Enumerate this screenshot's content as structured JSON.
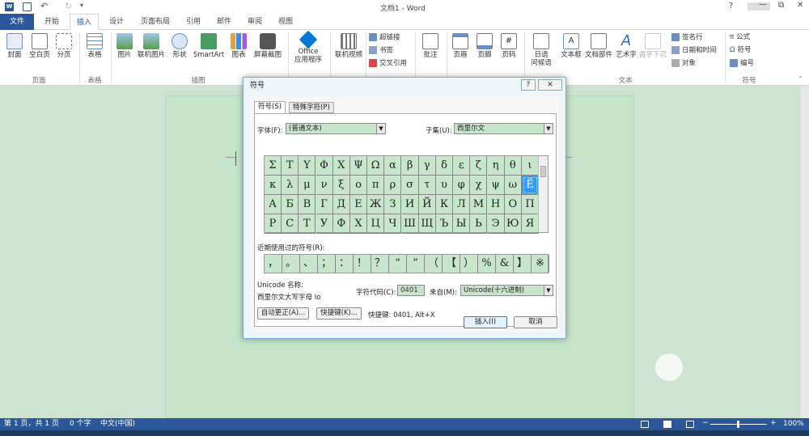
{
  "titlebar": {
    "title": "文档1 - Word",
    "help": "?",
    "restore": "⧉",
    "minimize": "—",
    "close": "✕"
  },
  "tabs": [
    "文件",
    "开始",
    "插入",
    "设计",
    "页面布局",
    "引用",
    "邮件",
    "审阅",
    "视图"
  ],
  "active_tab": "插入",
  "ribbon": {
    "pages": {
      "label": "页面",
      "items": [
        "封面",
        "空白页",
        "分页"
      ]
    },
    "tables": {
      "label": "表格",
      "items": [
        "表格"
      ]
    },
    "illustrations": {
      "label": "插图",
      "items": [
        "图片",
        "联机图片",
        "形状",
        "SmartArt",
        "图表",
        "屏幕截图"
      ]
    },
    "apps": {
      "items": [
        "Office",
        "应用程序"
      ],
      "label": "应用程序"
    },
    "media": {
      "items": [
        "联机视频"
      ],
      "label": "媒体"
    },
    "links": {
      "items": [
        "超链接",
        "书签",
        "交叉引用"
      ],
      "label": "链接"
    },
    "comments": {
      "items": [
        "批注"
      ],
      "label": "批注"
    },
    "header_footer": {
      "items": [
        "页眉",
        "页脚",
        "页码"
      ],
      "label": "页眉和页脚"
    },
    "text": {
      "items": [
        "日语",
        "问候语",
        "文本框",
        "文档部件",
        "艺术字",
        "首字下沉"
      ],
      "right": [
        "签名行",
        "日期和时间",
        "对象"
      ],
      "label": "文本"
    },
    "symbols": {
      "items": [
        "公式",
        "符号",
        "编号"
      ],
      "label": "符号"
    }
  },
  "dialog": {
    "title": "符号",
    "help": "?",
    "close": "✕",
    "tabs": [
      "符号(S)",
      "特殊字符(P)"
    ],
    "font_label": "字体(F):",
    "font_value": "(普通文本)",
    "subset_label": "子集(U):",
    "subset_value": "西里尔文",
    "grid": [
      [
        "Σ",
        "Τ",
        "Υ",
        "Φ",
        "Χ",
        "Ψ",
        "Ω",
        "α",
        "β",
        "γ",
        "δ",
        "ε",
        "ζ",
        "η",
        "θ",
        "ι"
      ],
      [
        "κ",
        "λ",
        "μ",
        "ν",
        "ξ",
        "ο",
        "π",
        "ρ",
        "σ",
        "τ",
        "υ",
        "φ",
        "χ",
        "ψ",
        "ω",
        "Ё"
      ],
      [
        "А",
        "Б",
        "В",
        "Г",
        "Д",
        "Е",
        "Ж",
        "З",
        "И",
        "Й",
        "К",
        "Л",
        "М",
        "Н",
        "О",
        "П"
      ],
      [
        "Р",
        "С",
        "Т",
        "У",
        "Ф",
        "Х",
        "Ц",
        "Ч",
        "Ш",
        "Щ",
        "Ъ",
        "Ы",
        "Ь",
        "Э",
        "Ю",
        "Я"
      ]
    ],
    "selected": "Ё",
    "recent_label": "近期使用过的符号(R):",
    "recent": [
      "，",
      "。",
      "、",
      "；",
      "：",
      "！",
      "？",
      "“",
      "”",
      "（",
      "【",
      "）",
      "%",
      "&",
      "】",
      "※"
    ],
    "unicode_name_label": "Unicode 名称:",
    "unicode_name_value": "西里尔文大写字母 Io",
    "char_code_label": "字符代码(C):",
    "char_code_value": "0401",
    "from_label": "来自(M):",
    "from_value": "Unicode(十六进制)",
    "autocorrect_btn": "自动更正(A)...",
    "shortcut_btn": "快捷键(K)...",
    "shortcut_text": "快捷键: 0401, Alt+X",
    "insert_btn": "插入(I)",
    "cancel_btn": "取消"
  },
  "status": {
    "page": "第 1 页，共 1 页",
    "words": "0 个字",
    "lang": "中文(中国)",
    "zoom": "100%",
    "zoom_minus": "−",
    "zoom_plus": "+"
  }
}
